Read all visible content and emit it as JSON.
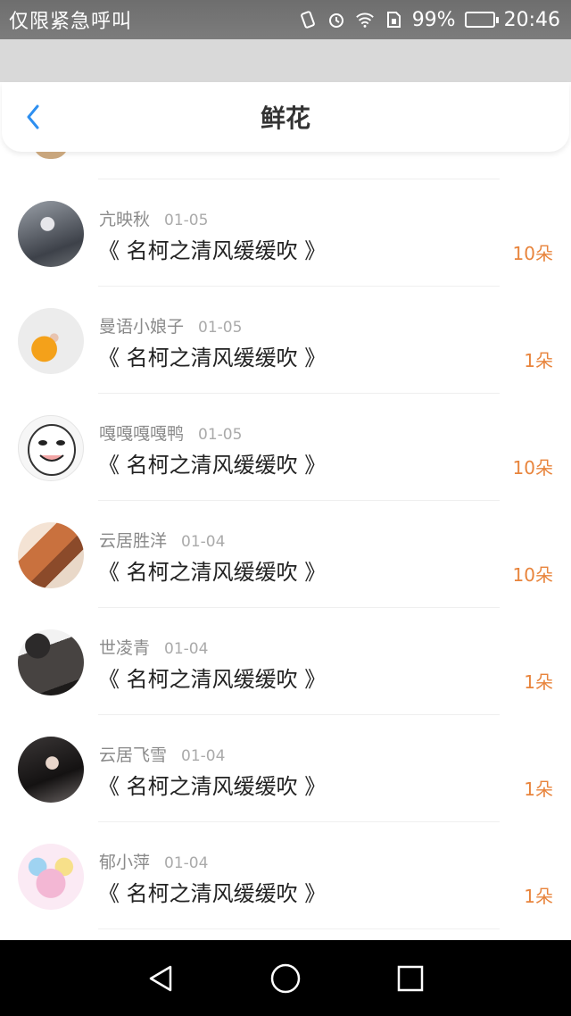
{
  "status_bar": {
    "carrier_text": "仅限紧急呼叫",
    "battery_percent": "99%",
    "battery_level": 0.99,
    "time": "20:46",
    "icons": [
      "vibrate-icon",
      "alarm-icon",
      "wifi-icon",
      "sim-icon",
      "battery-icon"
    ]
  },
  "header": {
    "title": "鲜花",
    "back_icon": "chevron-left-icon"
  },
  "colors": {
    "accent_blue": "#2e8ff0",
    "amount_orange": "#e8843c",
    "title_text": "#222222"
  },
  "list": {
    "items": [
      {
        "username": "亢映秋",
        "date": "01-05",
        "title": "《 名柯之清风缓缓吹 》",
        "amount": "10朵"
      },
      {
        "username": "曼语小娘子",
        "date": "01-05",
        "title": "《 名柯之清风缓缓吹 》",
        "amount": "1朵"
      },
      {
        "username": "嘎嘎嘎嘎鸭",
        "date": "01-05",
        "title": "《 名柯之清风缓缓吹 》",
        "amount": "10朵"
      },
      {
        "username": "云居胜洋",
        "date": "01-04",
        "title": "《 名柯之清风缓缓吹 》",
        "amount": "10朵"
      },
      {
        "username": "世凌青",
        "date": "01-04",
        "title": "《 名柯之清风缓缓吹 》",
        "amount": "1朵"
      },
      {
        "username": "云居飞雪",
        "date": "01-04",
        "title": "《 名柯之清风缓缓吹 》",
        "amount": "1朵"
      },
      {
        "username": "郁小萍",
        "date": "01-04",
        "title": "《 名柯之清风缓缓吹 》",
        "amount": "1朵"
      }
    ]
  },
  "nav_bar": {
    "icons": [
      "back-triangle-icon",
      "home-circle-icon",
      "recents-square-icon"
    ]
  }
}
